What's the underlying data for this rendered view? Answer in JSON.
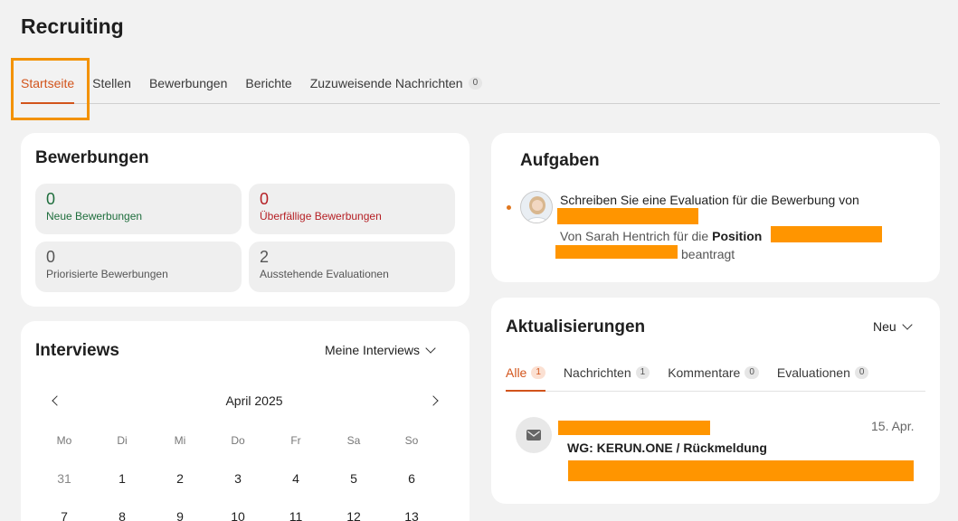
{
  "page": {
    "title": "Recruiting"
  },
  "tabs": [
    {
      "label": "Startseite",
      "active": true
    },
    {
      "label": "Stellen"
    },
    {
      "label": "Bewerbungen"
    },
    {
      "label": "Berichte"
    },
    {
      "label": "Zuzuweisende Nachrichten",
      "count": "0"
    }
  ],
  "applications": {
    "title": "Bewerbungen",
    "stats": [
      {
        "value": "0",
        "label": "Neue Bewerbungen"
      },
      {
        "value": "0",
        "label": "Überfällige Bewerbungen"
      },
      {
        "value": "0",
        "label": "Priorisierte Bewerbungen"
      },
      {
        "value": "2",
        "label": "Ausstehende Evaluationen"
      }
    ]
  },
  "interviews": {
    "title": "Interviews",
    "filter": "Meine Interviews",
    "month": "April 2025",
    "weekdays": [
      "Mo",
      "Di",
      "Mi",
      "Do",
      "Fr",
      "Sa",
      "So"
    ],
    "week1": [
      "31",
      "1",
      "2",
      "3",
      "4",
      "5",
      "6"
    ],
    "week2": [
      "7",
      "8",
      "9",
      "10",
      "11",
      "12",
      "13"
    ]
  },
  "tasks": {
    "title": "Aufgaben",
    "item": {
      "text": "Schreiben Sie eine Evaluation für die Bewerbung von",
      "by_prefix": "Von Sarah Hentrich für die",
      "position_label": "Position",
      "suffix": "beantragt"
    }
  },
  "updates": {
    "title": "Aktualisierungen",
    "filter": "Neu",
    "tabs": [
      {
        "label": "Alle",
        "count": "1",
        "active": true
      },
      {
        "label": "Nachrichten",
        "count": "1"
      },
      {
        "label": "Kommentare",
        "count": "0"
      },
      {
        "label": "Evaluationen",
        "count": "0"
      }
    ],
    "item": {
      "date": "15. Apr.",
      "subject": "WG: KERUN.ONE / Rückmeldung"
    }
  },
  "colors": {
    "accent": "#d2541b",
    "highlight": "#f39200",
    "redaction": "#ff9500"
  }
}
